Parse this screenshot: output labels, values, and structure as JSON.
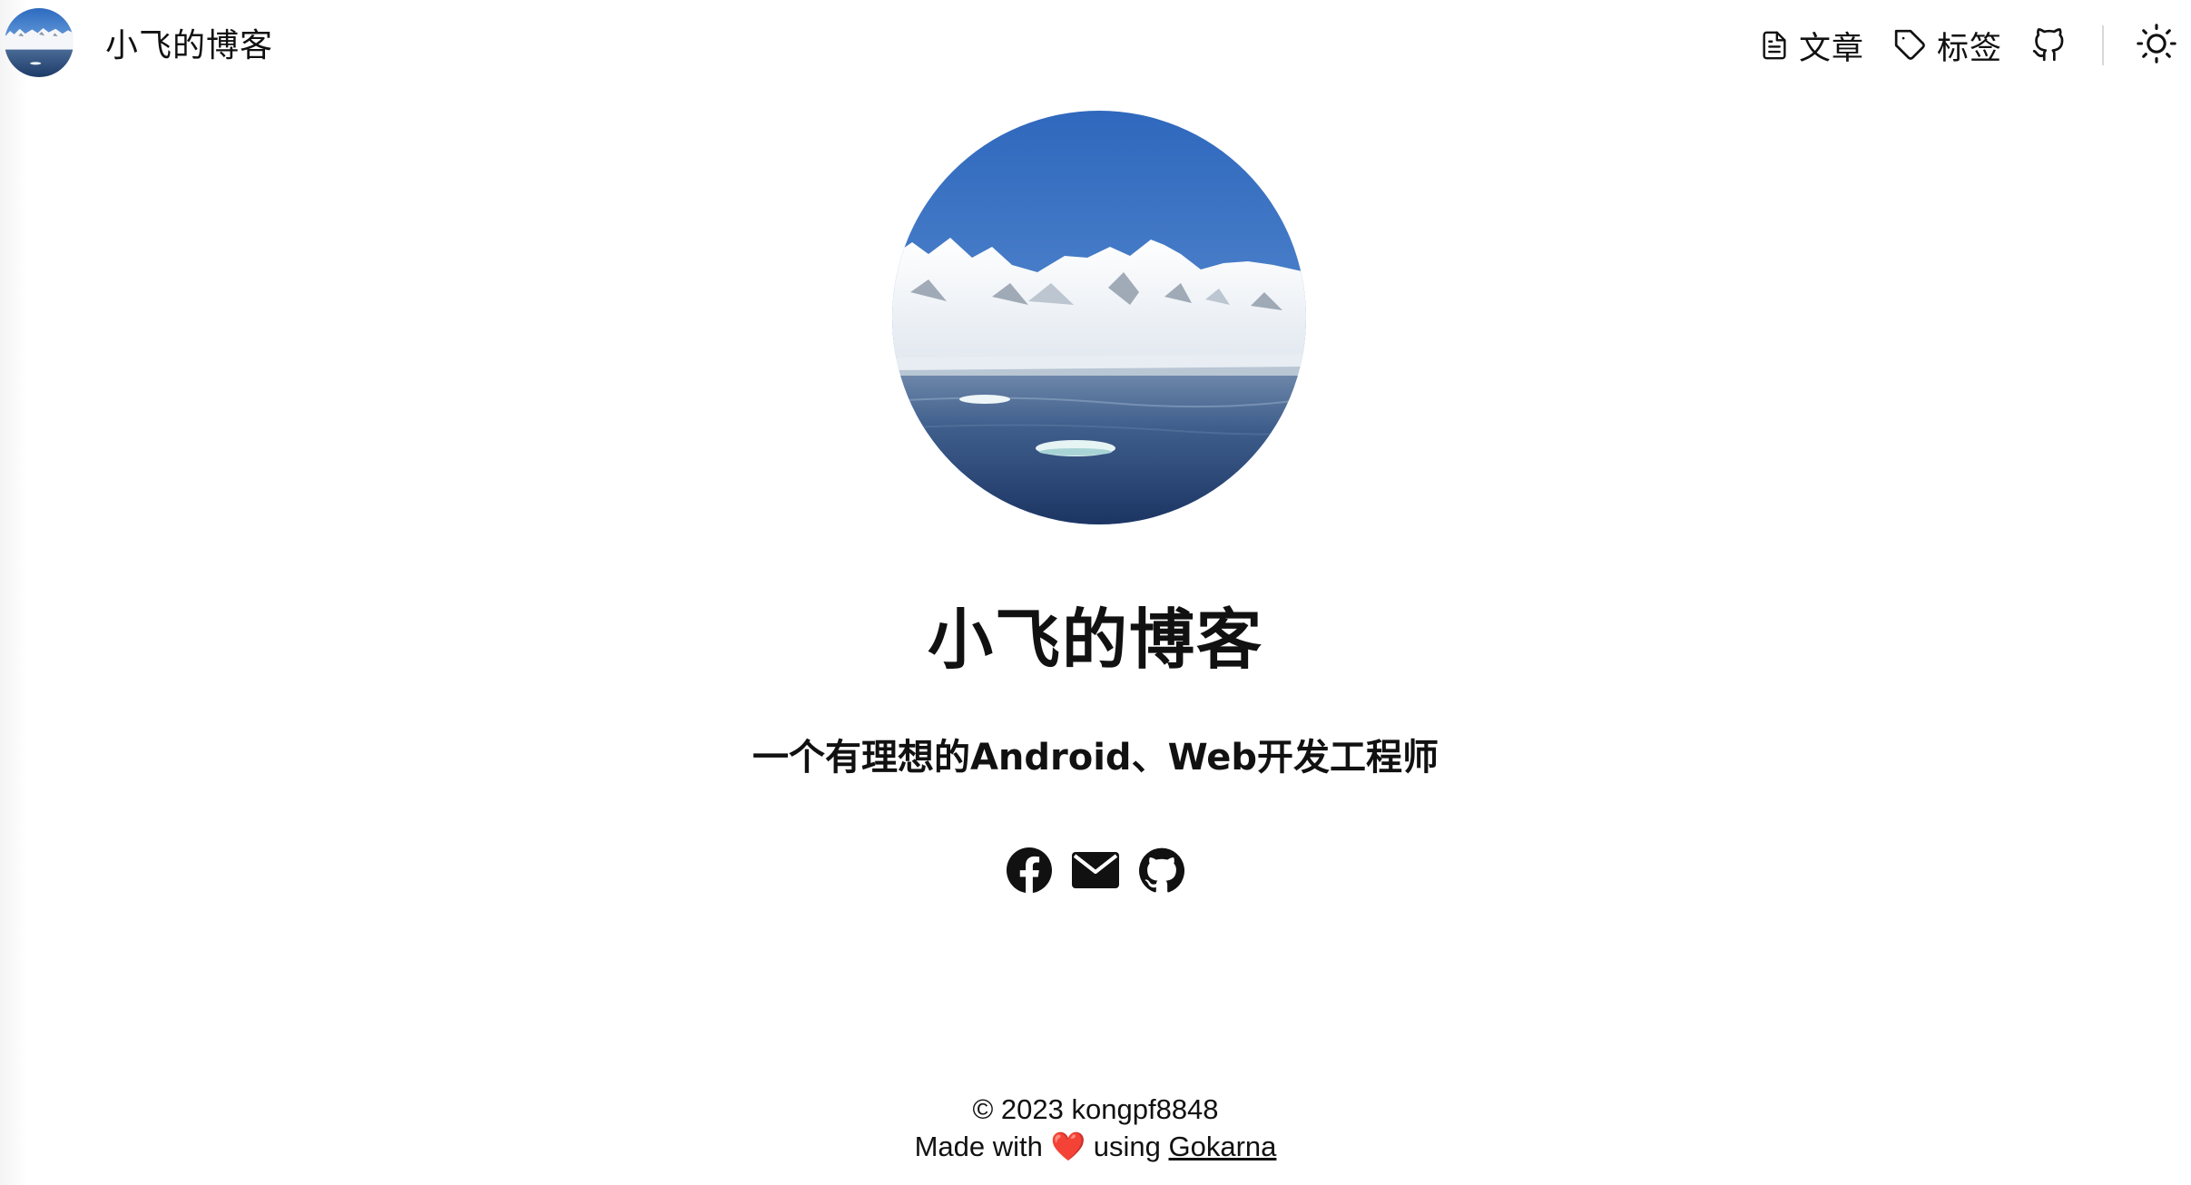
{
  "header": {
    "site_title": "小飞的博客",
    "nav": {
      "posts_label": "文章",
      "tags_label": "标签"
    }
  },
  "hero": {
    "title": "小飞的博客",
    "subtitle": "一个有理想的Android、Web开发工程师"
  },
  "social": {
    "icons": [
      "facebook-icon",
      "mail-icon",
      "github-icon"
    ]
  },
  "footer": {
    "copyright_symbol": "©",
    "year": "2023",
    "owner": "kongpf8848",
    "made_with": "Made with",
    "heart": "❤️",
    "using": "using",
    "framework_link": "Gokarna"
  },
  "colors": {
    "text": "#111111",
    "background": "#ffffff",
    "heart": "#e02020",
    "divider": "#d9d9d9"
  }
}
